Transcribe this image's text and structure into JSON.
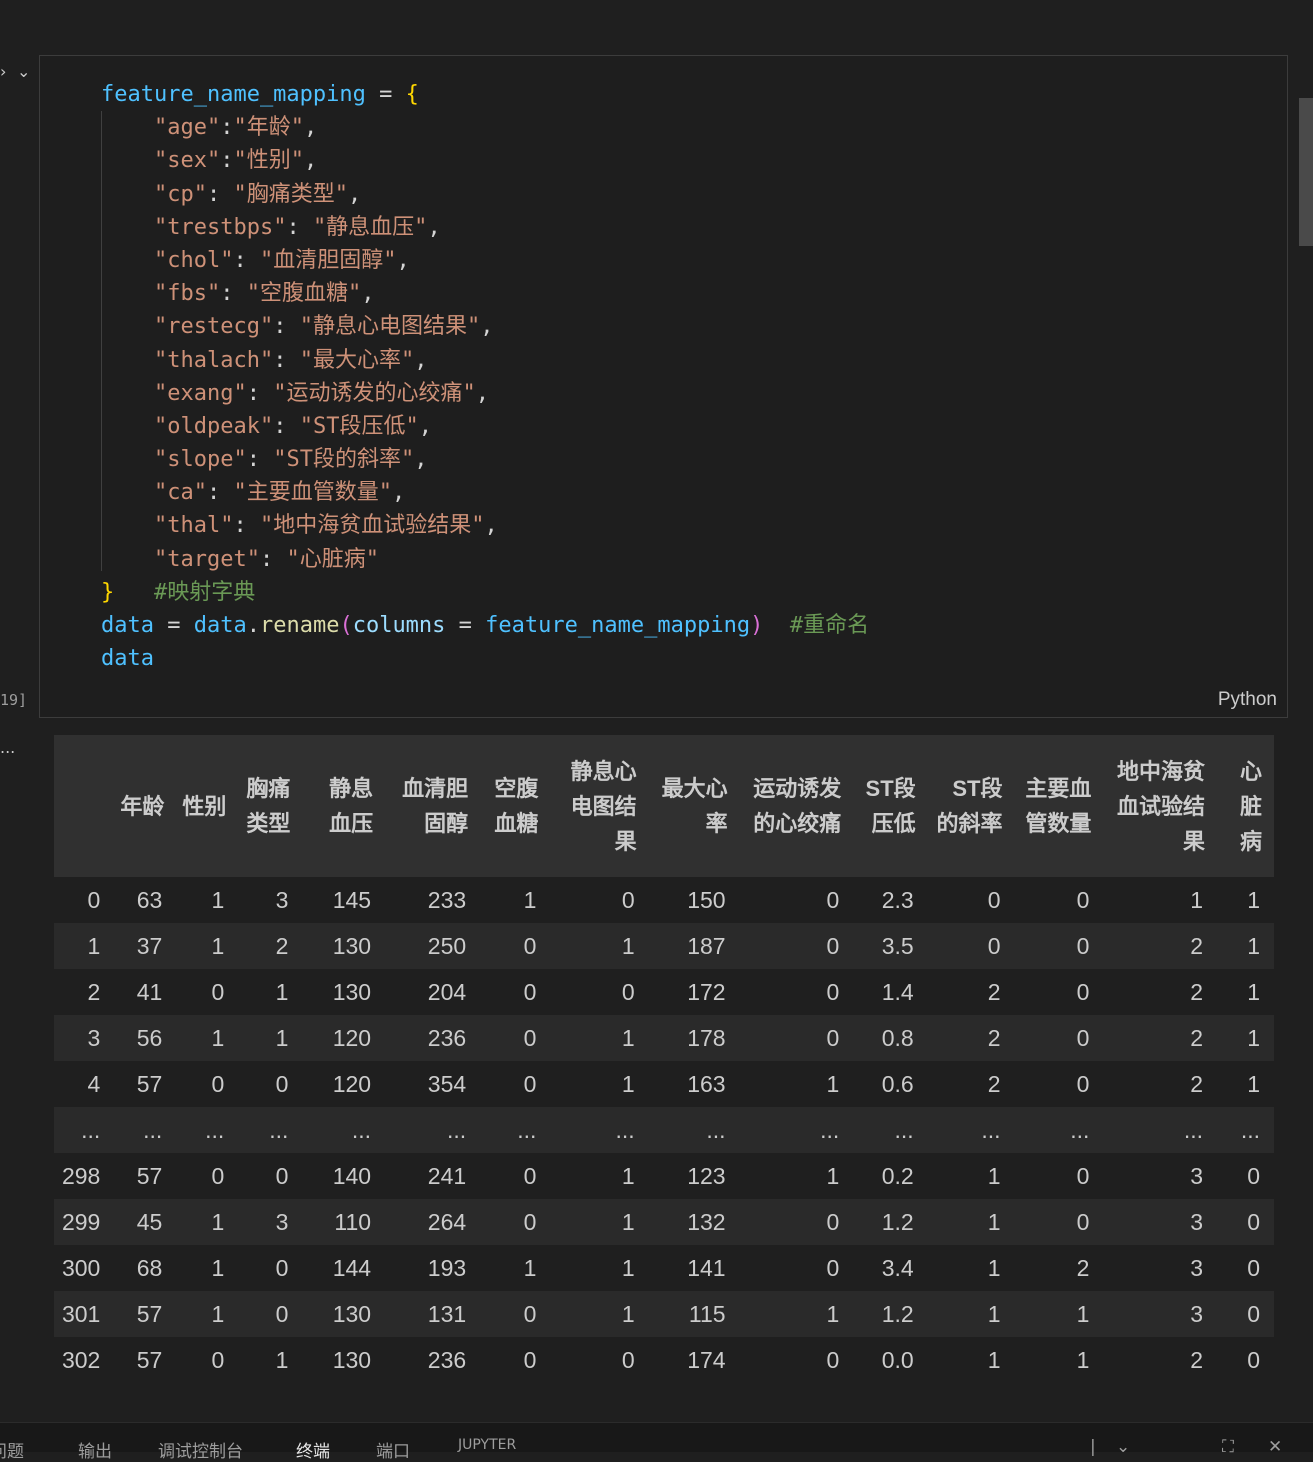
{
  "cell": {
    "exec_count": "19]",
    "language": "Python",
    "out_marker": "...",
    "code": {
      "l1_var": "feature_name_mapping",
      "eq": " = ",
      "open": "{",
      "close": "}",
      "entries": [
        {
          "key": "\"age\"",
          "sep": ":",
          "val": "\"年龄\"",
          "comma": ","
        },
        {
          "key": "\"sex\"",
          "sep": ":",
          "val": "\"性别\"",
          "comma": ","
        },
        {
          "key": "\"cp\"",
          "sep": ": ",
          "val": "\"胸痛类型\"",
          "comma": ","
        },
        {
          "key": "\"trestbps\"",
          "sep": ": ",
          "val": "\"静息血压\"",
          "comma": ","
        },
        {
          "key": "\"chol\"",
          "sep": ": ",
          "val": "\"血清胆固醇\"",
          "comma": ","
        },
        {
          "key": "\"fbs\"",
          "sep": ": ",
          "val": "\"空腹血糖\"",
          "comma": ","
        },
        {
          "key": "\"restecg\"",
          "sep": ": ",
          "val": "\"静息心电图结果\"",
          "comma": ","
        },
        {
          "key": "\"thalach\"",
          "sep": ": ",
          "val": "\"最大心率\"",
          "comma": ","
        },
        {
          "key": "\"exang\"",
          "sep": ": ",
          "val": "\"运动诱发的心绞痛\"",
          "comma": ","
        },
        {
          "key": "\"oldpeak\"",
          "sep": ": ",
          "val": "\"ST段压低\"",
          "comma": ","
        },
        {
          "key": "\"slope\"",
          "sep": ": ",
          "val": "\"ST段的斜率\"",
          "comma": ","
        },
        {
          "key": "\"ca\"",
          "sep": ": ",
          "val": "\"主要血管数量\"",
          "comma": ","
        },
        {
          "key": "\"thal\"",
          "sep": ": ",
          "val": "\"地中海贫血试验结果\"",
          "comma": ","
        },
        {
          "key": "\"target\"",
          "sep": ": ",
          "val": "\"心脏病\"",
          "comma": ""
        }
      ],
      "close_comment": "   #映射字典",
      "l_data": "data",
      "l_data2": "data",
      "l_rename": "rename",
      "l_columns": "columns",
      "l_mapping": "feature_name_mapping",
      "l_comment": "  #重命名",
      "l_last": "data"
    }
  },
  "table": {
    "headers": [
      "",
      "年龄",
      "性别",
      "胸痛类型",
      "静息血压",
      "血清胆固醇",
      "空腹血糖",
      "静息心电图结果",
      "最大心率",
      "运动诱发的心绞痛",
      "ST段压低",
      "ST段的斜率",
      "主要血管数量",
      "地中海贫血试验结果",
      "心脏病"
    ],
    "rows": [
      [
        "0",
        "63",
        "1",
        "3",
        "145",
        "233",
        "1",
        "0",
        "150",
        "0",
        "2.3",
        "0",
        "0",
        "1",
        "1"
      ],
      [
        "1",
        "37",
        "1",
        "2",
        "130",
        "250",
        "0",
        "1",
        "187",
        "0",
        "3.5",
        "0",
        "0",
        "2",
        "1"
      ],
      [
        "2",
        "41",
        "0",
        "1",
        "130",
        "204",
        "0",
        "0",
        "172",
        "0",
        "1.4",
        "2",
        "0",
        "2",
        "1"
      ],
      [
        "3",
        "56",
        "1",
        "1",
        "120",
        "236",
        "0",
        "1",
        "178",
        "0",
        "0.8",
        "2",
        "0",
        "2",
        "1"
      ],
      [
        "4",
        "57",
        "0",
        "0",
        "120",
        "354",
        "0",
        "1",
        "163",
        "1",
        "0.6",
        "2",
        "0",
        "2",
        "1"
      ],
      [
        "...",
        "...",
        "...",
        "...",
        "...",
        "...",
        "...",
        "...",
        "...",
        "...",
        "...",
        "...",
        "...",
        "...",
        "..."
      ],
      [
        "298",
        "57",
        "0",
        "0",
        "140",
        "241",
        "0",
        "1",
        "123",
        "1",
        "0.2",
        "1",
        "0",
        "3",
        "0"
      ],
      [
        "299",
        "45",
        "1",
        "3",
        "110",
        "264",
        "0",
        "1",
        "132",
        "0",
        "1.2",
        "1",
        "0",
        "3",
        "0"
      ],
      [
        "300",
        "68",
        "1",
        "0",
        "144",
        "193",
        "1",
        "1",
        "141",
        "0",
        "3.4",
        "1",
        "2",
        "3",
        "0"
      ],
      [
        "301",
        "57",
        "1",
        "0",
        "130",
        "131",
        "0",
        "1",
        "115",
        "1",
        "1.2",
        "1",
        "1",
        "3",
        "0"
      ],
      [
        "302",
        "57",
        "0",
        "1",
        "130",
        "236",
        "0",
        "0",
        "174",
        "0",
        "0.0",
        "1",
        "1",
        "2",
        "0"
      ]
    ]
  },
  "panel": {
    "tabs": [
      "问题",
      "输出",
      "调试控制台",
      "终端",
      "端口",
      "JUPYTER"
    ]
  }
}
